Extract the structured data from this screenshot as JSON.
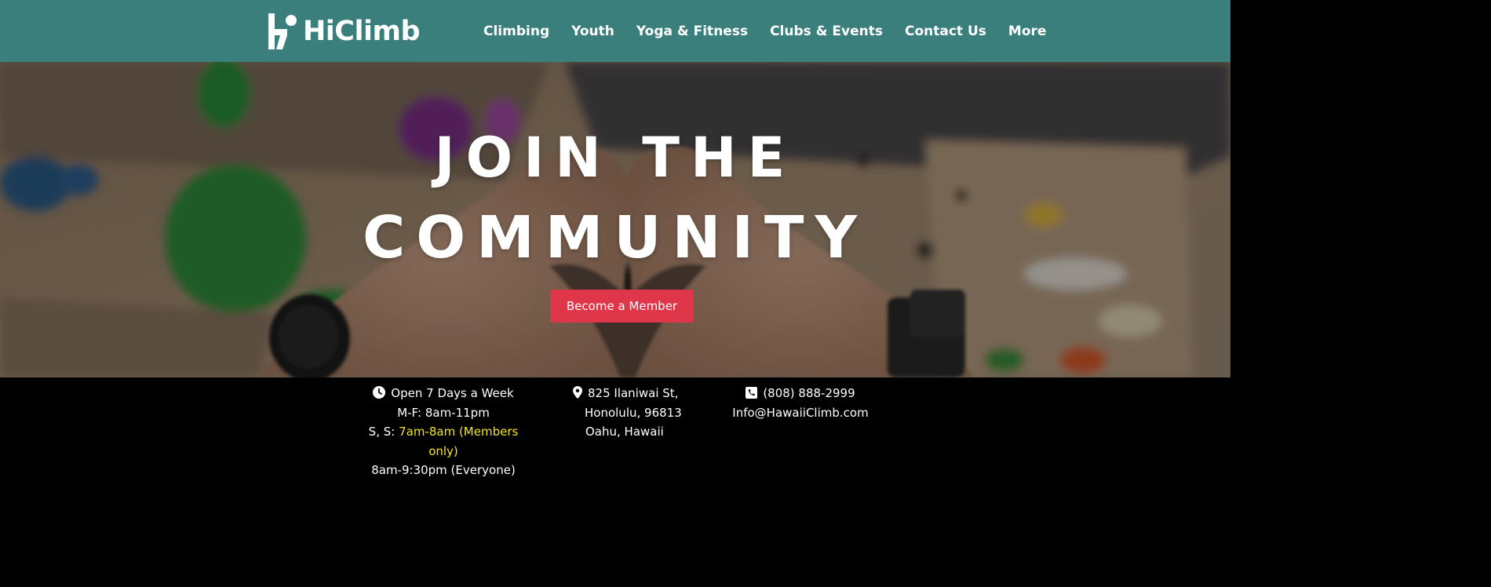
{
  "brand": {
    "name": "HiClimb",
    "logo_icon": "hi-climb-mark"
  },
  "nav": {
    "items": [
      {
        "label": "Climbing"
      },
      {
        "label": "Youth"
      },
      {
        "label": "Yoga & Fitness"
      },
      {
        "label": "Clubs & Events"
      },
      {
        "label": "Contact Us"
      },
      {
        "label": "More"
      }
    ]
  },
  "hero": {
    "title_line1": "JOIN THE",
    "title_line2": "COMMUNITY",
    "cta_label": "Become a Member",
    "cta_color": "#e0364a"
  },
  "hours": {
    "icon": "clock-icon",
    "line1": "Open 7 Days a Week",
    "line2": "M-F: 8am-11pm",
    "weekend_prefix": "S, S: ",
    "weekend_members_a": "7am-8am (Members",
    "weekend_members_b": "only)",
    "weekend_everyone": "8am-9:30pm (Everyone)",
    "highlight_color": "#f2e423"
  },
  "address": {
    "icon": "map-pin-icon",
    "street": "825 Ilaniwai St,",
    "city": "Honolulu, 96813",
    "region": "Oahu, Hawaii"
  },
  "contact": {
    "icon": "phone-icon",
    "phone": "(808) 888-2999",
    "email": "Info@HawaiiClimb.com"
  },
  "colors": {
    "header": "#3b7f7d",
    "footer": "#000000"
  }
}
